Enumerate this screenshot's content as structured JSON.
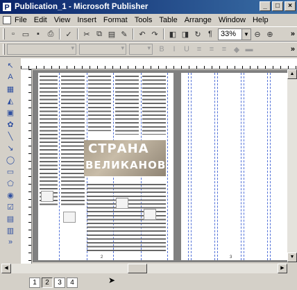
{
  "window": {
    "title": "Publication_1 - Microsoft Publisher",
    "app_icon_letter": "P",
    "controls": {
      "minimize": "_",
      "maximize": "□",
      "close": "×"
    }
  },
  "menubar": {
    "items": [
      "File",
      "Edit",
      "View",
      "Insert",
      "Format",
      "Tools",
      "Table",
      "Arrange",
      "Window",
      "Help"
    ]
  },
  "toolbar": {
    "zoom_value": "33%",
    "overflow": "»"
  },
  "document": {
    "banner_line1": "СТРАНА",
    "banner_line2": "ВЕЛИКАНОВ",
    "left_page_number": "2",
    "right_page_number": "3"
  },
  "page_navigator": {
    "pages": [
      "1",
      "2",
      "3",
      "4"
    ],
    "active_page": "2"
  },
  "icons": {
    "new": "new-document-icon",
    "open": "open-folder-icon",
    "save": "save-icon",
    "print": "print-icon",
    "zoom_out": "zoom-out-icon",
    "zoom_in": "zoom-in-icon"
  }
}
